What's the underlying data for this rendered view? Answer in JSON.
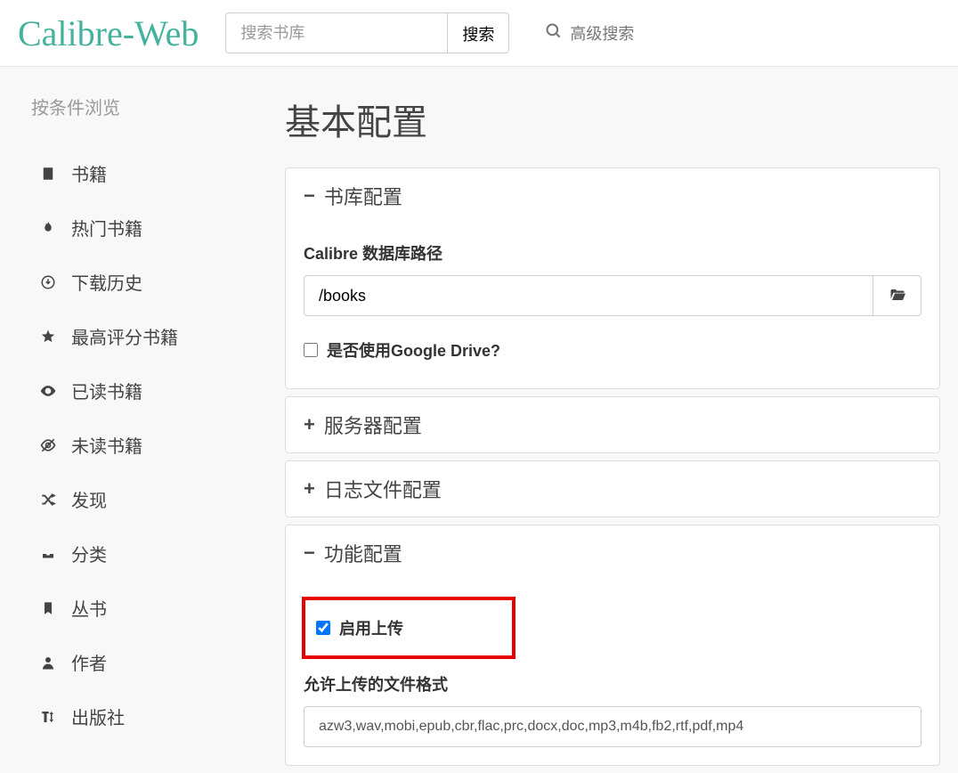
{
  "brand": "Calibre-Web",
  "search": {
    "placeholder": "搜索书库",
    "button": "搜索",
    "advanced": "高级搜索"
  },
  "sidebar": {
    "title": "按条件浏览",
    "items": [
      {
        "label": "书籍"
      },
      {
        "label": "热门书籍"
      },
      {
        "label": "下载历史"
      },
      {
        "label": "最高评分书籍"
      },
      {
        "label": "已读书籍"
      },
      {
        "label": "未读书籍"
      },
      {
        "label": "发现"
      },
      {
        "label": "分类"
      },
      {
        "label": "丛书"
      },
      {
        "label": "作者"
      },
      {
        "label": "出版社"
      }
    ]
  },
  "page": {
    "title": "基本配置",
    "sections": {
      "library": {
        "title": "书库配置",
        "db_label": "Calibre 数据库路径",
        "db_value": "/books",
        "gdrive_label": "是否使用Google Drive?"
      },
      "server": {
        "title": "服务器配置"
      },
      "log": {
        "title": "日志文件配置"
      },
      "feature": {
        "title": "功能配置",
        "upload_label": "启用上传",
        "formats_label": "允许上传的文件格式",
        "formats_value": "azw3,wav,mobi,epub,cbr,flac,prc,docx,doc,mp3,m4b,fb2,rtf,pdf,mp4"
      }
    }
  }
}
